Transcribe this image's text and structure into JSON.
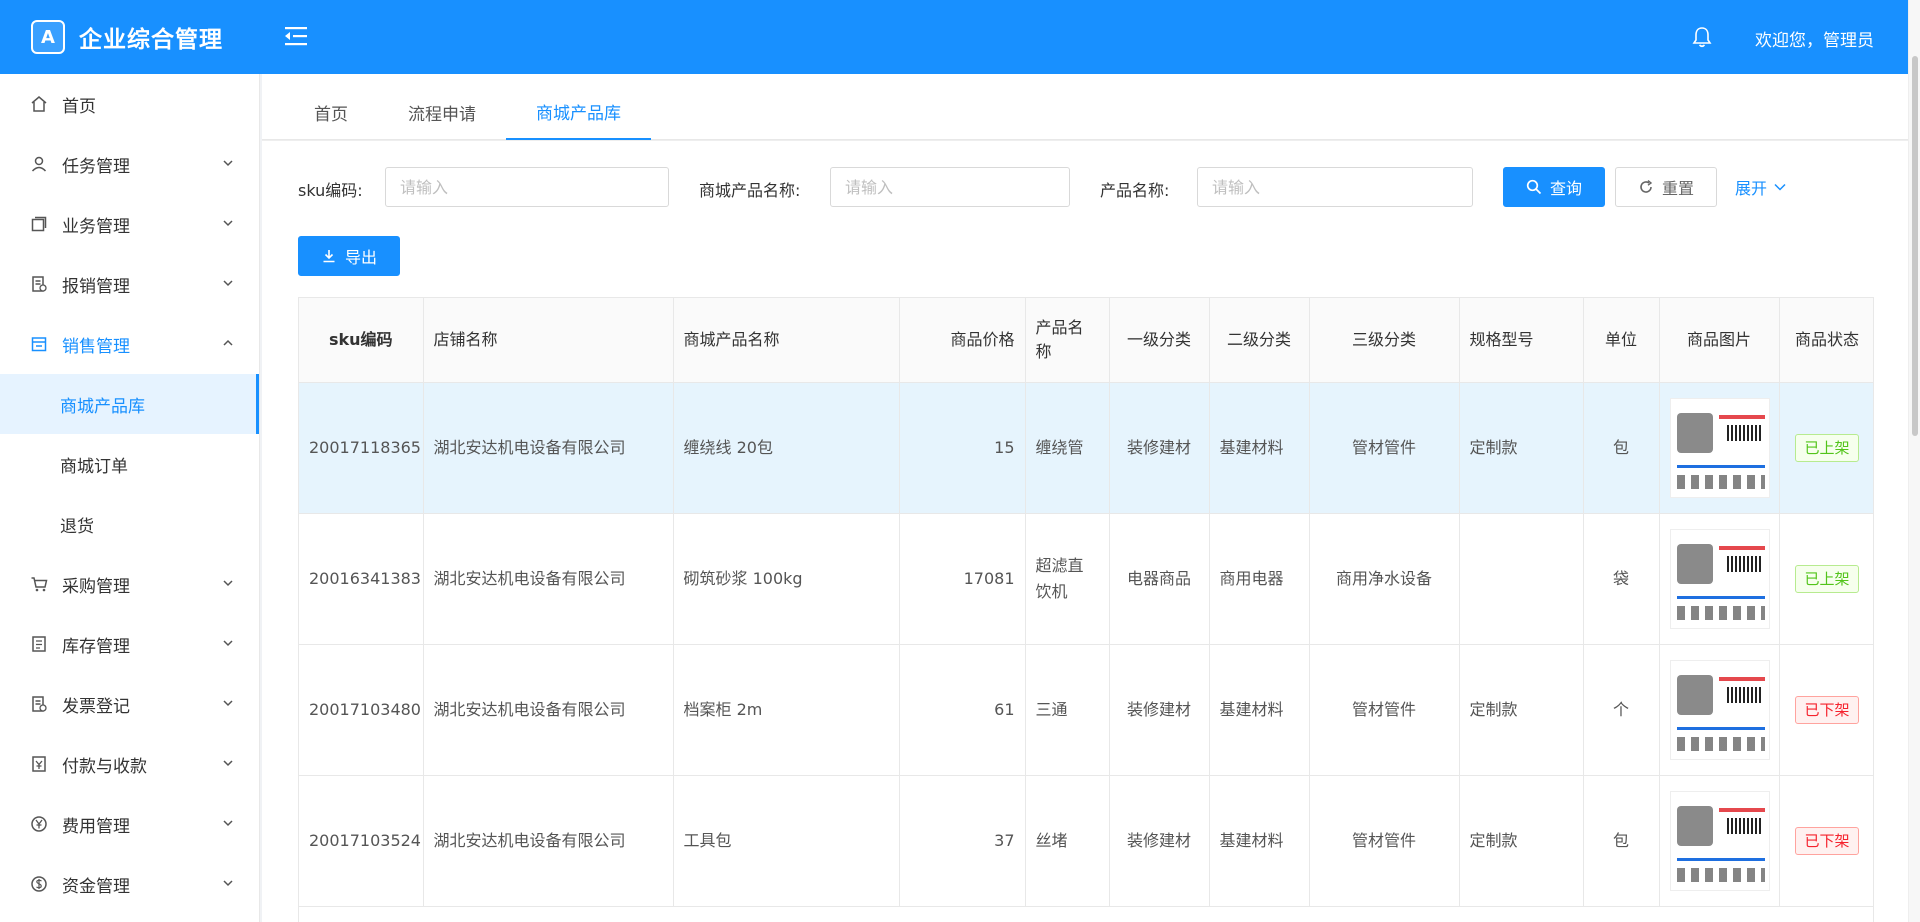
{
  "header": {
    "logo_glyph": "A",
    "title": "企业综合管理",
    "welcome": "欢迎您，管理员",
    "color": "#1890ff"
  },
  "sidebar": {
    "items": [
      {
        "label": "首页",
        "icon": "home-icon"
      },
      {
        "label": "任务管理",
        "icon": "user-icon"
      },
      {
        "label": "业务管理",
        "icon": "copy-icon"
      },
      {
        "label": "报销管理",
        "icon": "receipt-icon"
      },
      {
        "label": "销售管理",
        "icon": "shop-icon"
      },
      {
        "label": "采购管理",
        "icon": "cart-icon"
      },
      {
        "label": "库存管理",
        "icon": "inventory-icon"
      },
      {
        "label": "发票登记",
        "icon": "invoice-icon"
      },
      {
        "label": "付款与收款",
        "icon": "payment-icon"
      },
      {
        "label": "费用管理",
        "icon": "yen-icon"
      },
      {
        "label": "资金管理",
        "icon": "dollar-icon"
      }
    ],
    "sales_submenu": [
      "商城产品库",
      "商城订单",
      "退货"
    ]
  },
  "tabs": [
    "首页",
    "流程申请",
    "商城产品库"
  ],
  "search": {
    "sku_label": "sku编码:",
    "mall_name_label": "商城产品名称:",
    "product_name_label": "产品名称:",
    "placeholder": "请输入",
    "query_btn": "查询",
    "reset_btn": "重置",
    "expand_btn": "展开",
    "export_btn": "导出"
  },
  "table": {
    "headers": [
      "sku编码",
      "店铺名称",
      "商城产品名称",
      "商品价格",
      "产品名称",
      "一级分类",
      "二级分类",
      "三级分类",
      "规格型号",
      "单位",
      "商品图片",
      "商品状态"
    ],
    "rows": [
      {
        "sku": "20017118365",
        "shop": "湖北安达机电设备有限公司",
        "mall_name": "缠绕线 20包",
        "price": "15",
        "product": "缠绕管",
        "cat1": "装修建材",
        "cat2": "基建材料",
        "cat3": "管材管件",
        "spec": "定制款",
        "unit": "包",
        "status": "已上架"
      },
      {
        "sku": "20016341383",
        "shop": "湖北安达机电设备有限公司",
        "mall_name": "砌筑砂浆 100kg",
        "price": "17081",
        "product": "超滤直饮机",
        "cat1": "电器商品",
        "cat2": "商用电器",
        "cat3": "商用净水设备",
        "spec": "",
        "unit": "袋",
        "status": "已上架"
      },
      {
        "sku": "20017103480",
        "shop": "湖北安达机电设备有限公司",
        "mall_name": "档案柜 2m",
        "price": "61",
        "product": "三通",
        "cat1": "装修建材",
        "cat2": "基建材料",
        "cat3": "管材管件",
        "spec": "定制款",
        "unit": "个",
        "status": "已下架"
      },
      {
        "sku": "20017103524",
        "shop": "湖北安达机电设备有限公司",
        "mall_name": "工具包",
        "price": "37",
        "product": "丝堵",
        "cat1": "装修建材",
        "cat2": "基建材料",
        "cat3": "管材管件",
        "spec": "定制款",
        "unit": "包",
        "status": "已下架"
      }
    ]
  }
}
